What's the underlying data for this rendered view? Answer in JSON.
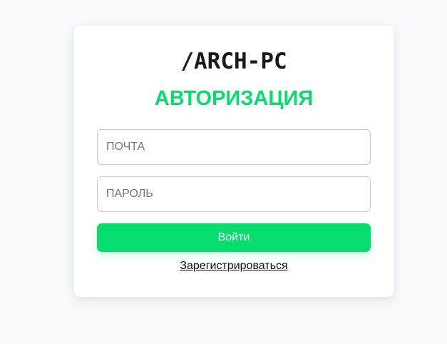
{
  "logo": "/ARCH-PC",
  "title": "АВТОРИЗАЦИЯ",
  "form": {
    "email_placeholder": "ПОЧТА",
    "email_value": "",
    "password_placeholder": "ПАРОЛЬ",
    "password_value": "",
    "login_label": "Войти",
    "register_label": "Зарегистрироваться"
  },
  "colors": {
    "accent": "#07dd6f",
    "background": "#f7f9fc",
    "card": "#ffffff",
    "text": "#1a1a1a"
  }
}
